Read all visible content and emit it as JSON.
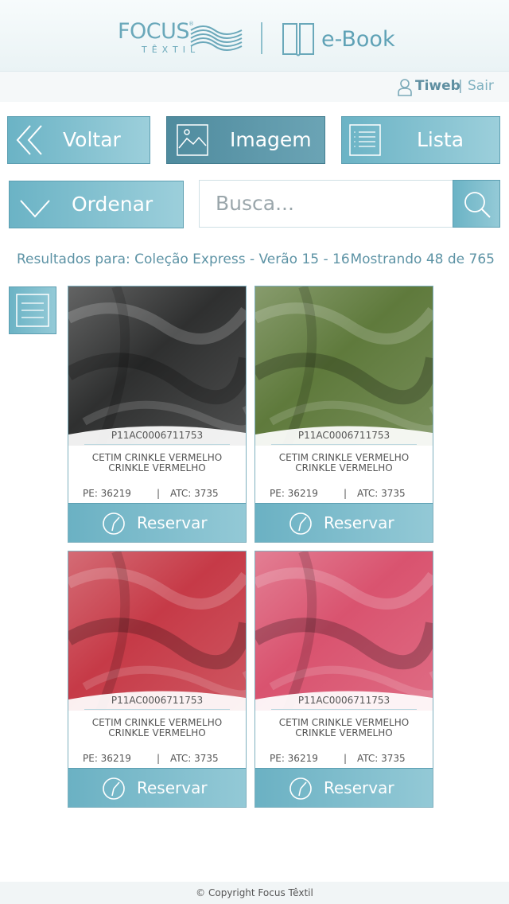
{
  "header": {
    "logo_text": "FOCUS",
    "logo_subtitle": "TÊXTIL",
    "logo_mark": "®",
    "app_label": "e-Book"
  },
  "user": {
    "name": "Tiweb",
    "separator": "|",
    "logout_label": "Sair"
  },
  "toolbar": {
    "back_label": "Voltar",
    "image_label": "Imagem",
    "list_label": "Lista",
    "sort_label": "Ordenar",
    "search_placeholder": "Busca...",
    "search_value": ""
  },
  "results": {
    "label": "Resultados para: Coleção Express - Verão 15 - 16",
    "showing": "Mostrando 48 de 765"
  },
  "products": [
    {
      "code": "P11AC0006711753",
      "name_line1": "CETIM CRINKLE VERMELHO",
      "name_line2": "CRINKLE VERMELHO",
      "pe": "PE: 36219",
      "sep": "|",
      "atc": "ATC: 3735",
      "reserve_label": "Reservar",
      "color": "#2f3030"
    },
    {
      "code": "P11AC0006711753",
      "name_line1": "CETIM CRINKLE VERMELHO",
      "name_line2": "CRINKLE VERMELHO",
      "pe": "PE: 36219",
      "sep": "|",
      "atc": "ATC: 3735",
      "reserve_label": "Reservar",
      "color": "#5f7a3c"
    },
    {
      "code": "P11AC0006711753",
      "name_line1": "CETIM CRINKLE VERMELHO",
      "name_line2": "CRINKLE VERMELHO",
      "pe": "PE: 36219",
      "sep": "|",
      "atc": "ATC: 3735",
      "reserve_label": "Reservar",
      "color": "#c63a47"
    },
    {
      "code": "P11AC0006711753",
      "name_line1": "CETIM CRINKLE VERMELHO",
      "name_line2": "CRINKLE VERMELHO",
      "pe": "PE: 36219",
      "sep": "|",
      "atc": "ATC: 3735",
      "reserve_label": "Reservar",
      "color": "#d9536f"
    }
  ],
  "footer": {
    "copyright": "© Copyright Focus Têxtil"
  },
  "colors": {
    "accent": "#6bb3c5",
    "accent_dark": "#4f8b9e",
    "text": "#5d93a5"
  }
}
